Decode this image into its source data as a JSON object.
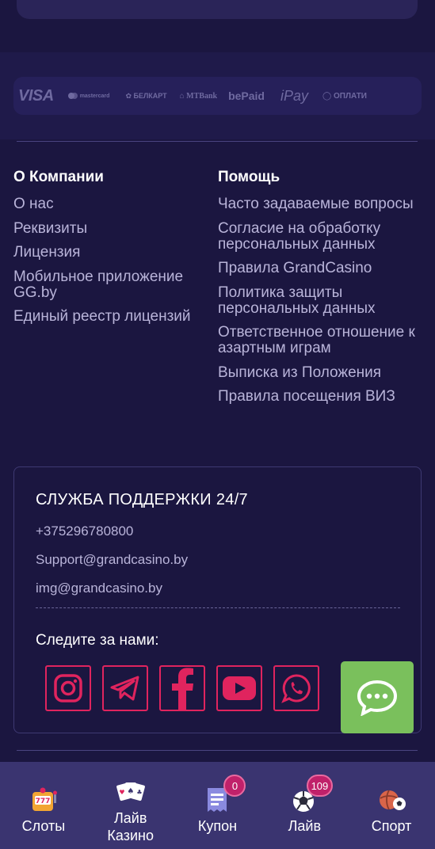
{
  "payments": {
    "visa": "VISA",
    "mastercard": "mastercard",
    "belkart": "БЕЛКАРТ",
    "mtbank": "MTBank",
    "bepaid": "bePaid",
    "ipay": "iPay",
    "oplati": "ОПЛАТИ"
  },
  "company": {
    "title": "О Компании",
    "links": [
      "О нас",
      "Реквизиты",
      "Лицензия",
      "Мобильное приложение GG.by",
      "Единый реестр лицензий"
    ]
  },
  "help": {
    "title": "Помощь",
    "links": [
      "Часто задаваемые вопросы",
      "Согласие на обработку персональных данных",
      "Правила GrandCasino",
      "Политика защиты персональных данных",
      "Ответственное отношение к азартным играм",
      "Выписка из Положения",
      "Правила посещения ВИЗ"
    ]
  },
  "support": {
    "title": "СЛУЖБА ПОДДЕРЖКИ 24/7",
    "phone": "+375296780800",
    "email_support": "Support@grandcasino.by",
    "email_img": "img@grandcasino.by",
    "follow": "Следите за нами:",
    "socials": [
      "instagram-icon",
      "telegram-icon",
      "facebook-icon",
      "youtube-icon",
      "whatsapp-icon"
    ]
  },
  "colors": {
    "background": "#1b1640",
    "accent": "#e0245e",
    "chat": "#7ac05c",
    "nav": "#3a3470"
  },
  "nav": {
    "slots": "Слоты",
    "live_casino": "Лайв Казино",
    "coupon": "Купон",
    "coupon_badge": "0",
    "live": "Лайв",
    "live_badge": "109",
    "sport": "Спорт"
  }
}
